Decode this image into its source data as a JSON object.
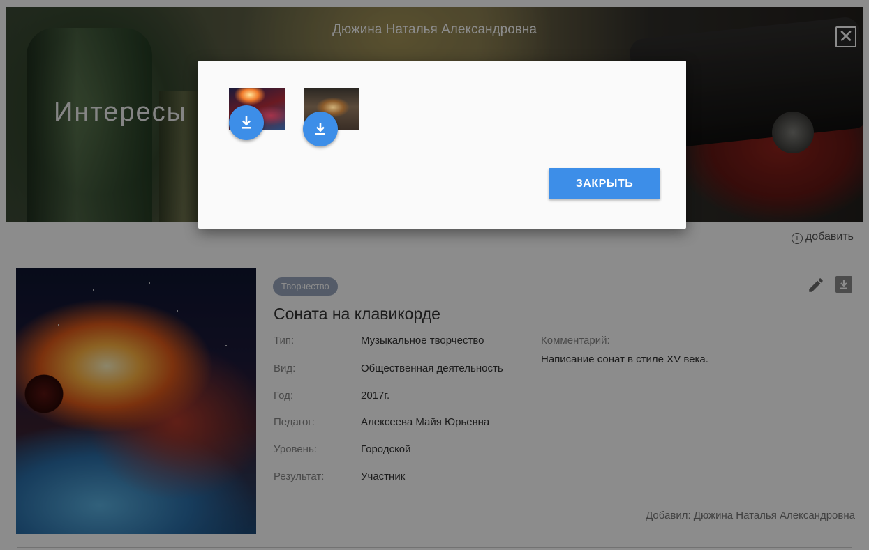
{
  "header": {
    "user_name": "Дюжина Наталья Александровна",
    "close_symbol": "✕",
    "section_title": "Интересы"
  },
  "toolbar": {
    "add_symbol": "+",
    "add_label": "добавить"
  },
  "item": {
    "category_badge": "Творчество",
    "title": "Соната на клавикорде",
    "fields": [
      {
        "label": "Тип:",
        "value": "Музыкальное творчество"
      },
      {
        "label": "Вид:",
        "value": "Общественная деятельность"
      },
      {
        "label": "Год:",
        "value": "2017г."
      },
      {
        "label": "Педагог:",
        "value": "Алексеева Майя Юрьевна"
      },
      {
        "label": "Уровень:",
        "value": "Городской"
      },
      {
        "label": "Результат:",
        "value": "Участник"
      }
    ],
    "comment_label": "Комментарий:",
    "comment_value": "Написание сонат в стиле XV века.",
    "added_by": "Добавил: Дюжина Наталья Александровна"
  },
  "modal": {
    "attachments": [
      {
        "name": "attachment-1",
        "icon": "download-icon"
      },
      {
        "name": "attachment-2",
        "icon": "download-icon"
      }
    ],
    "close_label": "ЗАКРЫТЬ"
  },
  "colors": {
    "accent": "#3d8ee8",
    "badge": "#9aa7bd",
    "backdrop": "rgba(0,0,0,0.45)"
  }
}
